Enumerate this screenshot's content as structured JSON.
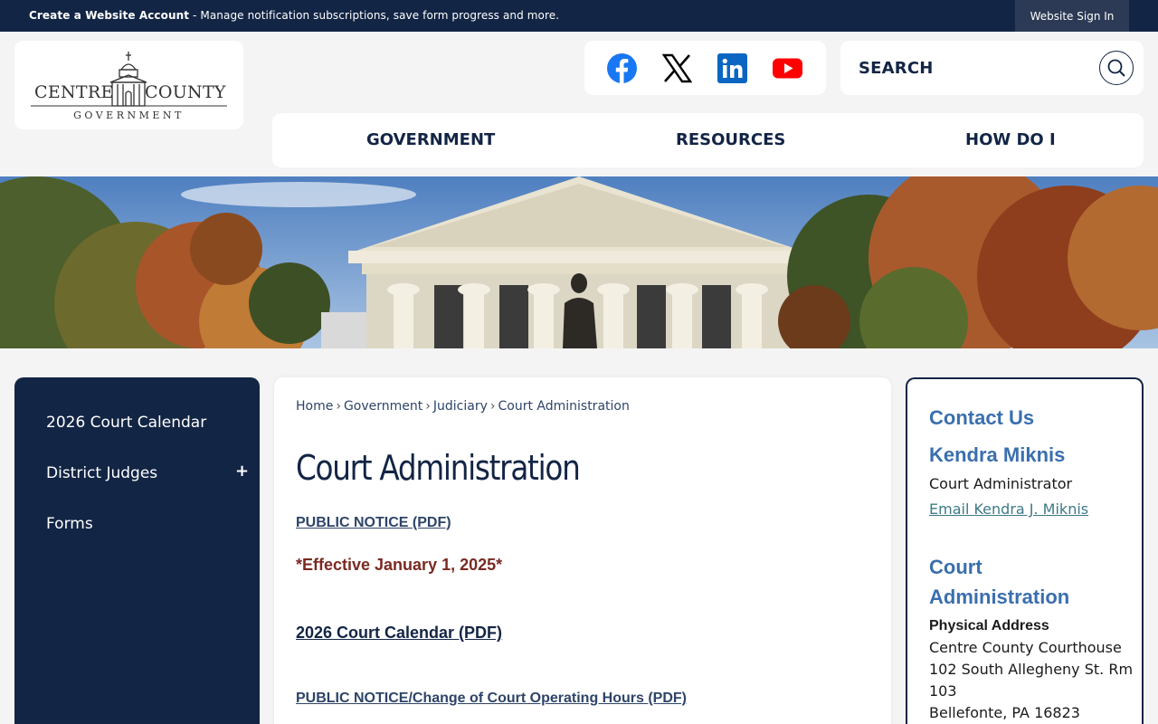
{
  "topbar": {
    "account_bold": "Create a Website Account",
    "account_text": " - Manage notification subscriptions, save form progress and more.",
    "signin_label": "Website Sign In"
  },
  "logo": {
    "left_word": "CENTRE",
    "right_word": "COUNTY",
    "sub": "GOVERNMENT"
  },
  "social": {
    "icons": [
      "facebook-icon",
      "x-twitter-icon",
      "linkedin-icon",
      "youtube-icon"
    ],
    "colors": {
      "facebook": "#1877f2",
      "x": "#000000",
      "linkedin": "#0a66c2",
      "youtube": "#ff0000"
    }
  },
  "search": {
    "placeholder": "SEARCH",
    "icon": "search-icon"
  },
  "nav": {
    "items": [
      "GOVERNMENT",
      "RESOURCES",
      "HOW DO I"
    ]
  },
  "sidebar": {
    "items": [
      "2026 Court Calendar",
      "District Judges",
      "Forms"
    ],
    "expand_symbol": "+"
  },
  "breadcrumb": {
    "items": [
      "Home",
      "Government",
      "Judiciary",
      "Court Administration"
    ],
    "separator": "›"
  },
  "main": {
    "title": "Court Administration",
    "public_notice": "PUBLIC NOTICE (PDF)",
    "effective": "*Effective January 1, 2025*",
    "calendar_link": "2026 Court Calendar (PDF)",
    "hours_link": "PUBLIC NOTICE/Change of Court Operating Hours (PDF)"
  },
  "contact": {
    "heading": "Contact Us",
    "name": "Kendra Miknis",
    "role": "Court Administrator",
    "email_link": "Email Kendra J. Miknis",
    "dept_line1": "Court",
    "dept_line2": "Administration",
    "address_label": "Physical Address",
    "address_lines": [
      "Centre County Courthouse",
      "102 South Allegheny St. Rm",
      "103",
      "Bellefonte, PA 16823"
    ]
  },
  "colors": {
    "navy": "#132545",
    "link": "#2e4468",
    "accent_blue": "#3a6fae",
    "effective_red": "#7a2a22"
  }
}
